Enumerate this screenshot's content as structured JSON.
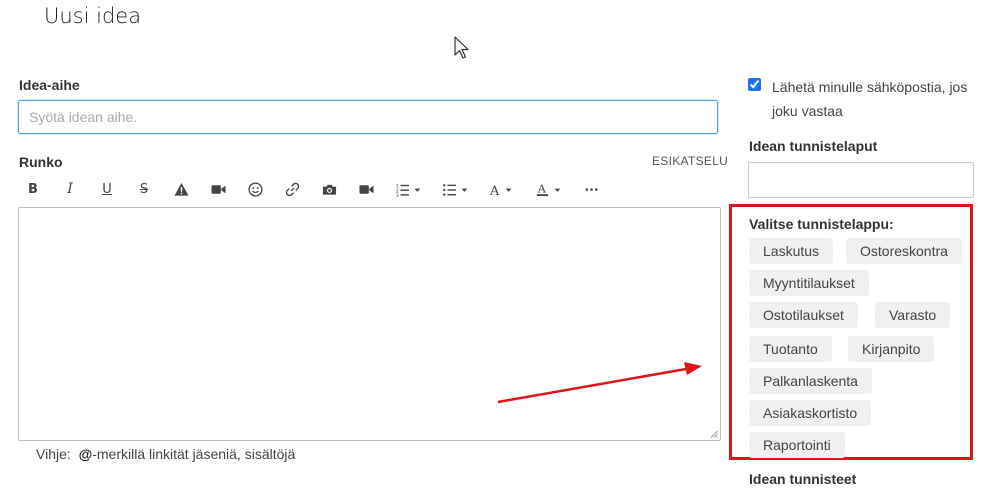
{
  "page": {
    "title": "Uusi idea"
  },
  "subject": {
    "label": "Idea-aihe",
    "placeholder": "Syötä idean aihe."
  },
  "body": {
    "label": "Runko",
    "preview": "ESIKATSELU"
  },
  "toolbar": {
    "items": [
      {
        "name": "bold-icon",
        "glyph": "B"
      },
      {
        "name": "italic-icon",
        "glyph": "I"
      },
      {
        "name": "underline-icon",
        "glyph": "U"
      },
      {
        "name": "strikethrough-icon",
        "glyph": "S"
      },
      {
        "name": "warning-icon",
        "glyph": "⚠"
      },
      {
        "name": "video-icon",
        "glyph": "■"
      },
      {
        "name": "emoji-icon",
        "glyph": "☺"
      },
      {
        "name": "link-icon",
        "glyph": "🔗"
      },
      {
        "name": "camera-icon",
        "glyph": "📷"
      },
      {
        "name": "media-icon",
        "glyph": "■"
      },
      {
        "name": "ordered-list-icon",
        "glyph": "≡"
      },
      {
        "name": "bullet-list-icon",
        "glyph": "☰"
      },
      {
        "name": "font-size-icon",
        "glyph": "A"
      },
      {
        "name": "font-color-icon",
        "glyph": "A"
      },
      {
        "name": "more-icon",
        "glyph": "···"
      }
    ]
  },
  "hint": {
    "prefix": "Vihje:",
    "mention": "@",
    "text": "-merkillä linkität jäseniä, sisältöjä"
  },
  "email": {
    "checked": true,
    "label": "Lähetä minulle sähköpostia, jos joku vastaa"
  },
  "tags": {
    "label": "Idean tunnistelaput",
    "select_label": "Valitse tunnistelappu:",
    "chips": [
      "Laskutus",
      "Ostoreskontra",
      "Myyntitilaukset",
      "Ostotilaukset",
      "Varasto",
      "Tuotanto",
      "Kirjanpito",
      "Palkanlaskenta",
      "Asiakaskortisto",
      "Raportointi"
    ],
    "ids_label": "Idean tunnisteet"
  },
  "colors": {
    "accent": "#4a9fd8",
    "highlight": "#e0141b",
    "chip_bg": "#f0f0f0"
  }
}
